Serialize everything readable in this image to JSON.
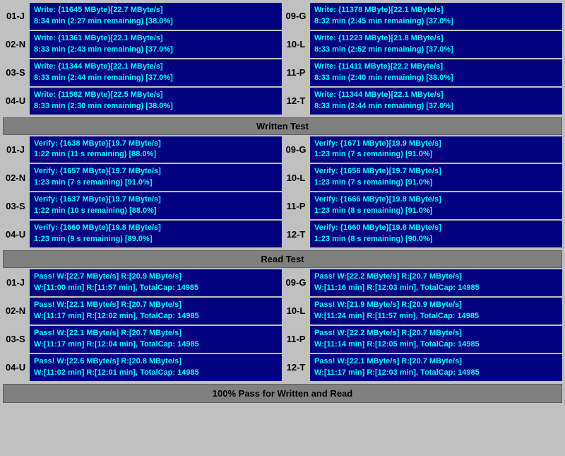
{
  "sections": {
    "write_test": {
      "rows": [
        {
          "left": {
            "id": "01-J",
            "line1": "Write: {11645 MByte}[22.7 MByte/s]",
            "line2": "8:34 min (2:27 min remaining)  [38.0%]"
          },
          "right": {
            "id": "09-G",
            "line1": "Write: {11378 MByte}[22.1 MByte/s]",
            "line2": "8:32 min (2:45 min remaining)  [37.0%]"
          }
        },
        {
          "left": {
            "id": "02-N",
            "line1": "Write: {11361 MByte}[22.1 MByte/s]",
            "line2": "8:33 min (2:43 min remaining)  [37.0%]"
          },
          "right": {
            "id": "10-L",
            "line1": "Write: {11223 MByte}[21.8 MByte/s]",
            "line2": "8:33 min (2:52 min remaining)  [37.0%]"
          }
        },
        {
          "left": {
            "id": "03-S",
            "line1": "Write: {11344 MByte}[22.1 MByte/s]",
            "line2": "8:33 min (2:44 min remaining)  [37.0%]"
          },
          "right": {
            "id": "11-P",
            "line1": "Write: {11411 MByte}[22.2 MByte/s]",
            "line2": "8:33 min (2:40 min remaining)  [38.0%]"
          }
        },
        {
          "left": {
            "id": "04-U",
            "line1": "Write: {11582 MByte}[22.5 MByte/s]",
            "line2": "8:33 min (2:30 min remaining)  [38.0%]"
          },
          "right": {
            "id": "12-T",
            "line1": "Write: {11344 MByte}[22.1 MByte/s]",
            "line2": "8:33 min (2:44 min remaining)  [37.0%]"
          }
        }
      ],
      "header": "Written Test"
    },
    "verify_test": {
      "rows": [
        {
          "left": {
            "id": "01-J",
            "line1": "Verify: {1638 MByte}[19.7 MByte/s]",
            "line2": "1:22 min (11 s remaining)   [88.0%]"
          },
          "right": {
            "id": "09-G",
            "line1": "Verify: {1671 MByte}[19.9 MByte/s]",
            "line2": "1:23 min (7 s remaining)   [91.0%]"
          }
        },
        {
          "left": {
            "id": "02-N",
            "line1": "Verify: {1657 MByte}[19.7 MByte/s]",
            "line2": "1:23 min (7 s remaining)   [91.0%]"
          },
          "right": {
            "id": "10-L",
            "line1": "Verify: {1656 MByte}[19.7 MByte/s]",
            "line2": "1:23 min (7 s remaining)   [91.0%]"
          }
        },
        {
          "left": {
            "id": "03-S",
            "line1": "Verify: {1637 MByte}[19.7 MByte/s]",
            "line2": "1:22 min (10 s remaining)   [88.0%]"
          },
          "right": {
            "id": "11-P",
            "line1": "Verify: {1666 MByte}[19.8 MByte/s]",
            "line2": "1:23 min (8 s remaining)   [91.0%]"
          }
        },
        {
          "left": {
            "id": "04-U",
            "line1": "Verify: {1660 MByte}[19.8 MByte/s]",
            "line2": "1:23 min (9 s remaining)   [89.0%]"
          },
          "right": {
            "id": "12-T",
            "line1": "Verify: {1660 MByte}[19.8 MByte/s]",
            "line2": "1:23 min (8 s remaining)   [90.0%]"
          }
        }
      ],
      "header": "Read Test"
    },
    "pass_test": {
      "rows": [
        {
          "left": {
            "id": "01-J",
            "line1": "Pass! W:[22.7 MByte/s] R:[20.9 MByte/s]",
            "line2": " W:[11:00 min] R:[11:57 min], TotalCap: 14985"
          },
          "right": {
            "id": "09-G",
            "line1": "Pass! W:[22.2 MByte/s] R:[20.7 MByte/s]",
            "line2": " W:[11:16 min] R:[12:03 min], TotalCap: 14985"
          }
        },
        {
          "left": {
            "id": "02-N",
            "line1": "Pass! W:[22.1 MByte/s] R:[20.7 MByte/s]",
            "line2": " W:[11:17 min] R:[12:02 min], TotalCap: 14985"
          },
          "right": {
            "id": "10-L",
            "line1": "Pass! W:[21.9 MByte/s] R:[20.9 MByte/s]",
            "line2": " W:[11:24 min] R:[11:57 min], TotalCap: 14985"
          }
        },
        {
          "left": {
            "id": "03-S",
            "line1": "Pass! W:[22.1 MByte/s] R:[20.7 MByte/s]",
            "line2": " W:[11:17 min] R:[12:04 min], TotalCap: 14985"
          },
          "right": {
            "id": "11-P",
            "line1": "Pass! W:[22.2 MByte/s] R:[20.7 MByte/s]",
            "line2": " W:[11:14 min] R:[12:05 min], TotalCap: 14985"
          }
        },
        {
          "left": {
            "id": "04-U",
            "line1": "Pass! W:[22.6 MByte/s] R:[20.8 MByte/s]",
            "line2": " W:[11:02 min] R:[12:01 min], TotalCap: 14985"
          },
          "right": {
            "id": "12-T",
            "line1": "Pass! W:[22.1 MByte/s] R:[20.7 MByte/s]",
            "line2": " W:[11:17 min] R:[12:03 min], TotalCap: 14985"
          }
        }
      ],
      "header": "Read Test"
    }
  },
  "footer": "100% Pass for Written and Read"
}
